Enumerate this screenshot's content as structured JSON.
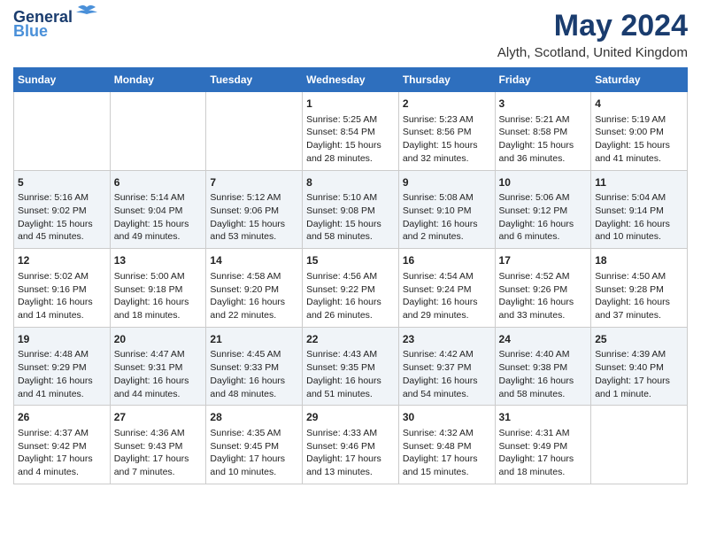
{
  "logo": {
    "line1": "General",
    "line2": "Blue"
  },
  "title": "May 2024",
  "subtitle": "Alyth, Scotland, United Kingdom",
  "days_of_week": [
    "Sunday",
    "Monday",
    "Tuesday",
    "Wednesday",
    "Thursday",
    "Friday",
    "Saturday"
  ],
  "weeks": [
    [
      {
        "day": "",
        "info": ""
      },
      {
        "day": "",
        "info": ""
      },
      {
        "day": "",
        "info": ""
      },
      {
        "day": "1",
        "info": "Sunrise: 5:25 AM\nSunset: 8:54 PM\nDaylight: 15 hours\nand 28 minutes."
      },
      {
        "day": "2",
        "info": "Sunrise: 5:23 AM\nSunset: 8:56 PM\nDaylight: 15 hours\nand 32 minutes."
      },
      {
        "day": "3",
        "info": "Sunrise: 5:21 AM\nSunset: 8:58 PM\nDaylight: 15 hours\nand 36 minutes."
      },
      {
        "day": "4",
        "info": "Sunrise: 5:19 AM\nSunset: 9:00 PM\nDaylight: 15 hours\nand 41 minutes."
      }
    ],
    [
      {
        "day": "5",
        "info": "Sunrise: 5:16 AM\nSunset: 9:02 PM\nDaylight: 15 hours\nand 45 minutes."
      },
      {
        "day": "6",
        "info": "Sunrise: 5:14 AM\nSunset: 9:04 PM\nDaylight: 15 hours\nand 49 minutes."
      },
      {
        "day": "7",
        "info": "Sunrise: 5:12 AM\nSunset: 9:06 PM\nDaylight: 15 hours\nand 53 minutes."
      },
      {
        "day": "8",
        "info": "Sunrise: 5:10 AM\nSunset: 9:08 PM\nDaylight: 15 hours\nand 58 minutes."
      },
      {
        "day": "9",
        "info": "Sunrise: 5:08 AM\nSunset: 9:10 PM\nDaylight: 16 hours\nand 2 minutes."
      },
      {
        "day": "10",
        "info": "Sunrise: 5:06 AM\nSunset: 9:12 PM\nDaylight: 16 hours\nand 6 minutes."
      },
      {
        "day": "11",
        "info": "Sunrise: 5:04 AM\nSunset: 9:14 PM\nDaylight: 16 hours\nand 10 minutes."
      }
    ],
    [
      {
        "day": "12",
        "info": "Sunrise: 5:02 AM\nSunset: 9:16 PM\nDaylight: 16 hours\nand 14 minutes."
      },
      {
        "day": "13",
        "info": "Sunrise: 5:00 AM\nSunset: 9:18 PM\nDaylight: 16 hours\nand 18 minutes."
      },
      {
        "day": "14",
        "info": "Sunrise: 4:58 AM\nSunset: 9:20 PM\nDaylight: 16 hours\nand 22 minutes."
      },
      {
        "day": "15",
        "info": "Sunrise: 4:56 AM\nSunset: 9:22 PM\nDaylight: 16 hours\nand 26 minutes."
      },
      {
        "day": "16",
        "info": "Sunrise: 4:54 AM\nSunset: 9:24 PM\nDaylight: 16 hours\nand 29 minutes."
      },
      {
        "day": "17",
        "info": "Sunrise: 4:52 AM\nSunset: 9:26 PM\nDaylight: 16 hours\nand 33 minutes."
      },
      {
        "day": "18",
        "info": "Sunrise: 4:50 AM\nSunset: 9:28 PM\nDaylight: 16 hours\nand 37 minutes."
      }
    ],
    [
      {
        "day": "19",
        "info": "Sunrise: 4:48 AM\nSunset: 9:29 PM\nDaylight: 16 hours\nand 41 minutes."
      },
      {
        "day": "20",
        "info": "Sunrise: 4:47 AM\nSunset: 9:31 PM\nDaylight: 16 hours\nand 44 minutes."
      },
      {
        "day": "21",
        "info": "Sunrise: 4:45 AM\nSunset: 9:33 PM\nDaylight: 16 hours\nand 48 minutes."
      },
      {
        "day": "22",
        "info": "Sunrise: 4:43 AM\nSunset: 9:35 PM\nDaylight: 16 hours\nand 51 minutes."
      },
      {
        "day": "23",
        "info": "Sunrise: 4:42 AM\nSunset: 9:37 PM\nDaylight: 16 hours\nand 54 minutes."
      },
      {
        "day": "24",
        "info": "Sunrise: 4:40 AM\nSunset: 9:38 PM\nDaylight: 16 hours\nand 58 minutes."
      },
      {
        "day": "25",
        "info": "Sunrise: 4:39 AM\nSunset: 9:40 PM\nDaylight: 17 hours\nand 1 minute."
      }
    ],
    [
      {
        "day": "26",
        "info": "Sunrise: 4:37 AM\nSunset: 9:42 PM\nDaylight: 17 hours\nand 4 minutes."
      },
      {
        "day": "27",
        "info": "Sunrise: 4:36 AM\nSunset: 9:43 PM\nDaylight: 17 hours\nand 7 minutes."
      },
      {
        "day": "28",
        "info": "Sunrise: 4:35 AM\nSunset: 9:45 PM\nDaylight: 17 hours\nand 10 minutes."
      },
      {
        "day": "29",
        "info": "Sunrise: 4:33 AM\nSunset: 9:46 PM\nDaylight: 17 hours\nand 13 minutes."
      },
      {
        "day": "30",
        "info": "Sunrise: 4:32 AM\nSunset: 9:48 PM\nDaylight: 17 hours\nand 15 minutes."
      },
      {
        "day": "31",
        "info": "Sunrise: 4:31 AM\nSunset: 9:49 PM\nDaylight: 17 hours\nand 18 minutes."
      },
      {
        "day": "",
        "info": ""
      }
    ]
  ]
}
